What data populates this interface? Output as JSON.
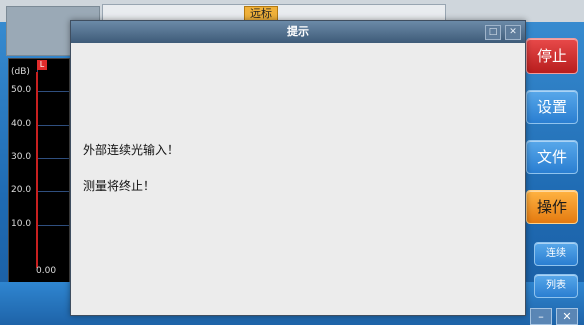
{
  "background": {
    "marker_tab": "远标",
    "y_unit": "(dB)",
    "y_ticks": [
      "50.0",
      "40.0",
      "30.0",
      "20.0",
      "10.0"
    ],
    "x_start": "0.00",
    "marker_label": "L"
  },
  "sidebar": {
    "stop": "停止",
    "settings": "设置",
    "file": "文件",
    "operate": "操作",
    "continuous": "连续",
    "list": "列表"
  },
  "dialog": {
    "title": "提示",
    "message_line1": "外部连续光输入！",
    "message_line2": "测量将终止！",
    "icons": [
      "maximize-icon",
      "close-icon"
    ]
  },
  "window_controls": {
    "minimize": "–",
    "close": "✕"
  },
  "colors": {
    "accent_blue": "#2f7fc2",
    "stop_red": "#c62828",
    "operate_orange": "#f0a020",
    "dialog_bg": "#ececec",
    "titlebar": "#4c6a88"
  }
}
